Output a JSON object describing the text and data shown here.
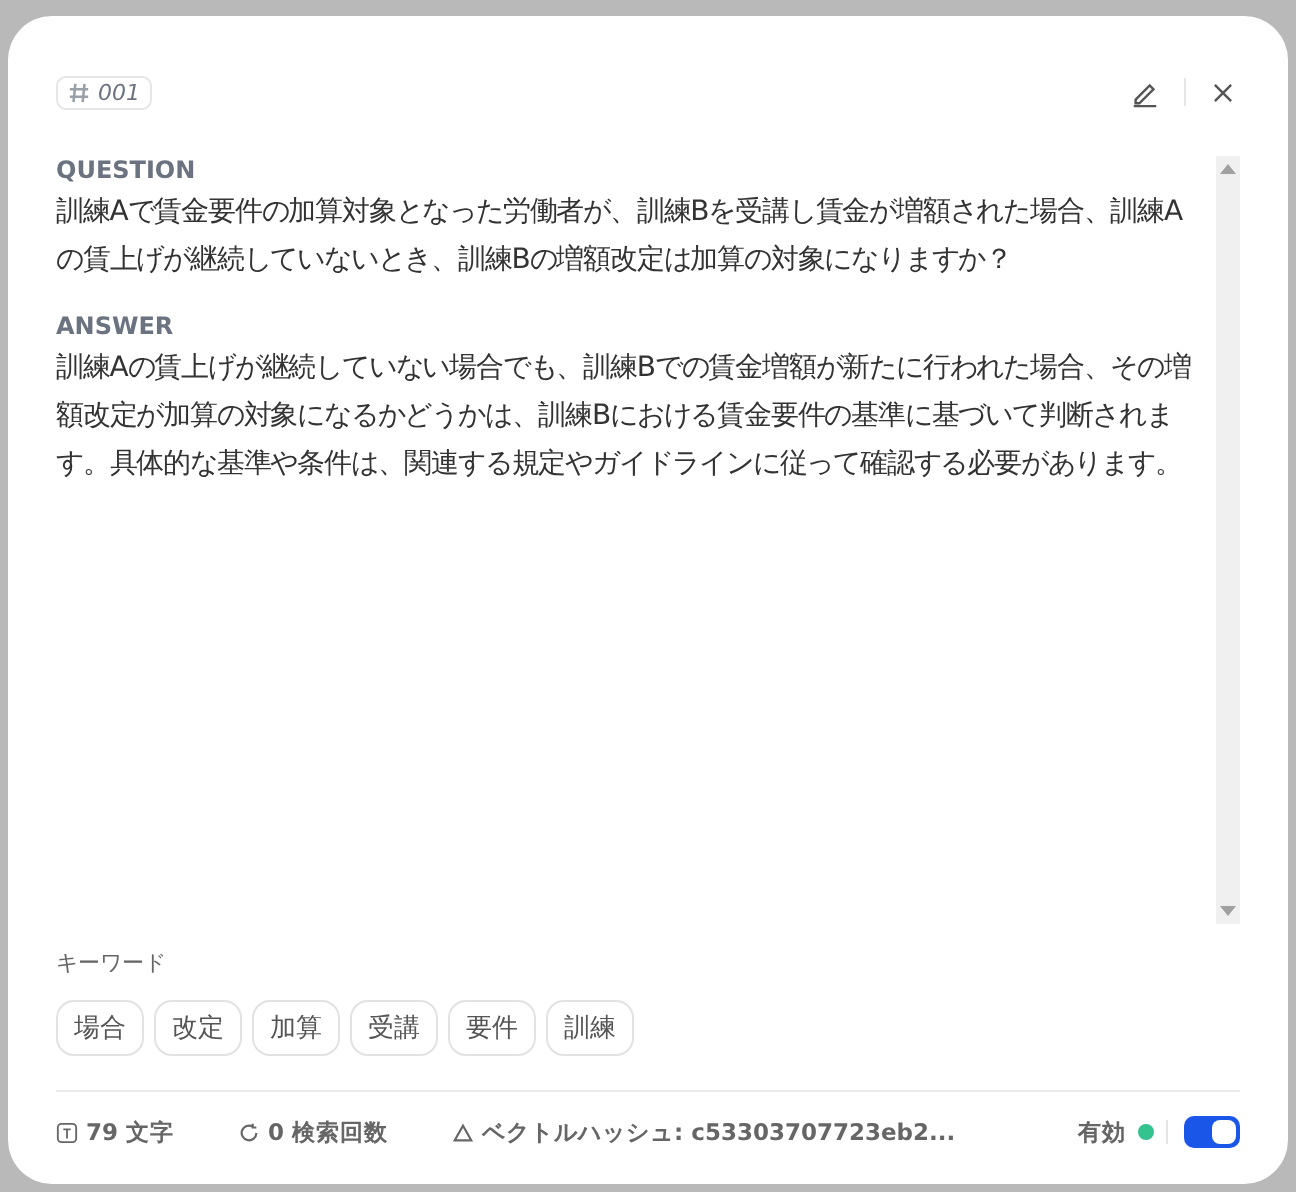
{
  "id_tag": "001",
  "question": {
    "label": "QUESTION",
    "text": "訓練Aで賃金要件の加算対象となった労働者が、訓練Bを受講し賃金が増額された場合、訓練Aの賃上げが継続していないとき、訓練Bの増額改定は加算の対象になりますか？"
  },
  "answer": {
    "label": "ANSWER",
    "text": "訓練Aの賃上げが継続していない場合でも、訓練Bでの賃金増額が新たに行われた場合、その増額改定が加算の対象になるかどうかは、訓練Bにおける賃金要件の基準に基づいて判断されます。具体的な基準や条件は、関連する規定やガイドラインに従って確認する必要があります。"
  },
  "keywords": {
    "label": "キーワード",
    "items": [
      "場合",
      "改定",
      "加算",
      "受講",
      "要件",
      "訓練"
    ]
  },
  "footer": {
    "char_count": "79 文字",
    "search_count": "0 検索回数",
    "vector_hash": "ベクトルハッシュ: c53303707723eb2...",
    "status_label": "有効",
    "enabled": true
  }
}
